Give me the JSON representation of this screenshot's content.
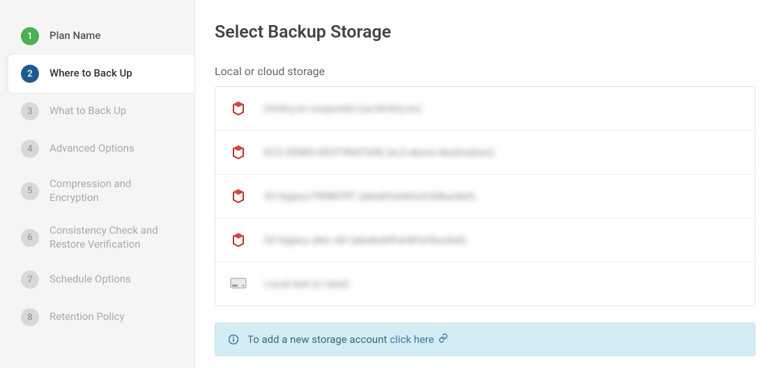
{
  "sidebar": {
    "steps": [
      {
        "num": "1",
        "label": "Plan Name",
        "state": "completed"
      },
      {
        "num": "2",
        "label": "Where to Back Up",
        "state": "current"
      },
      {
        "num": "3",
        "label": "What to Back Up",
        "state": "pending"
      },
      {
        "num": "4",
        "label": "Advanced Options",
        "state": "pending"
      },
      {
        "num": "5",
        "label": "Compression and Encryption",
        "state": "pending"
      },
      {
        "num": "6",
        "label": "Consistency Check and Restore Verification",
        "state": "pending"
      },
      {
        "num": "7",
        "label": "Schedule Options",
        "state": "pending"
      },
      {
        "num": "8",
        "label": "Retention Policy",
        "state": "pending"
      }
    ]
  },
  "main": {
    "title": "Select Backup Storage",
    "section_label": "Local or cloud storage",
    "storage_items": [
      {
        "label": "Dmitry.ev corporate (sa-dmitry-ev)",
        "type": "s3"
      },
      {
        "label": "EC2-DEMO-DESTINATION (ec2-demo-destination)",
        "type": "s3"
      },
      {
        "label": "S3 legacy FRNKFRT (alexkfrankfurtcblbucket)",
        "type": "s3"
      },
      {
        "label": "S3 legacy alex cbl (alexkcblfrankfurtbucket)",
        "type": "s3"
      },
      {
        "label": "Local test (c:\\test)",
        "type": "local"
      }
    ],
    "info_text": "To add a new storage account",
    "info_link": "click here"
  }
}
